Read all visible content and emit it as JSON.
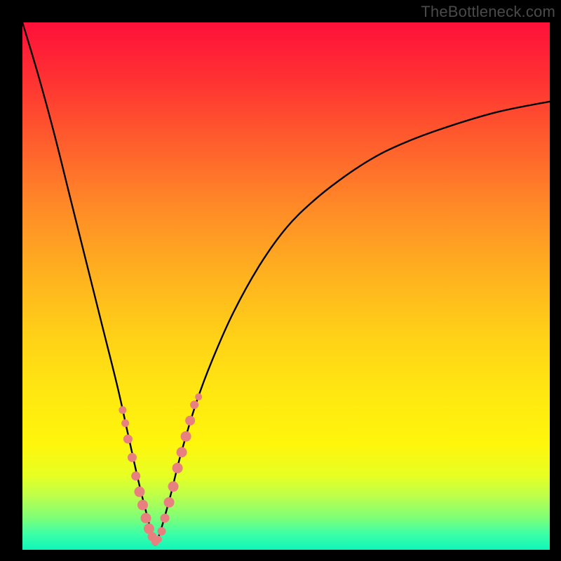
{
  "watermark": "TheBottleneck.com",
  "chart_data": {
    "type": "line",
    "title": "",
    "xlabel": "",
    "ylabel": "",
    "xlim": [
      0,
      100
    ],
    "ylim": [
      0,
      100
    ],
    "grid": false,
    "legend": false,
    "notes": "V-shaped bottleneck curve on gradient background; y represents bottleneck percentage (lower/green = better). Minimum near x≈25.",
    "series": [
      {
        "name": "bottleneck-curve",
        "x": [
          0,
          3,
          6,
          9,
          12,
          15,
          18,
          20,
          22,
          24,
          25,
          26,
          28,
          30,
          33,
          36,
          40,
          45,
          50,
          55,
          60,
          66,
          72,
          80,
          90,
          100
        ],
        "values": [
          100,
          90,
          79,
          67,
          55,
          43,
          31,
          22,
          13,
          5,
          1,
          3,
          10,
          18,
          28,
          36,
          45,
          54,
          61,
          66,
          70,
          74,
          77,
          80,
          83,
          85
        ]
      }
    ],
    "markers": {
      "name": "cluster-points",
      "note": "pink bead markers clustered near the curve minimum",
      "x": [
        19.0,
        19.5,
        20.0,
        20.8,
        21.5,
        22.2,
        22.8,
        23.4,
        24.0,
        24.6,
        25.2,
        25.8,
        26.4,
        27.0,
        27.8,
        28.6,
        29.4,
        30.2,
        31.0,
        31.8,
        32.6,
        33.4
      ],
      "values": [
        26.5,
        24.0,
        21.0,
        17.5,
        14.0,
        11.0,
        8.5,
        6.0,
        4.0,
        2.5,
        1.5,
        2.0,
        3.5,
        6.0,
        9.0,
        12.0,
        15.5,
        18.5,
        21.5,
        24.5,
        27.5,
        29.0
      ],
      "radius": [
        5.5,
        5.5,
        6.5,
        6.5,
        6.5,
        7.5,
        7.5,
        7.5,
        7.5,
        6.5,
        5.5,
        5.0,
        6.0,
        6.5,
        7.5,
        7.5,
        7.5,
        7.5,
        7.5,
        7.0,
        6.0,
        5.0
      ]
    },
    "gradient_stops": [
      {
        "pos": 0.0,
        "color": "#ff103a"
      },
      {
        "pos": 0.5,
        "color": "#ffd217"
      },
      {
        "pos": 0.85,
        "color": "#fff60c"
      },
      {
        "pos": 1.0,
        "color": "#10f5b8"
      }
    ]
  }
}
